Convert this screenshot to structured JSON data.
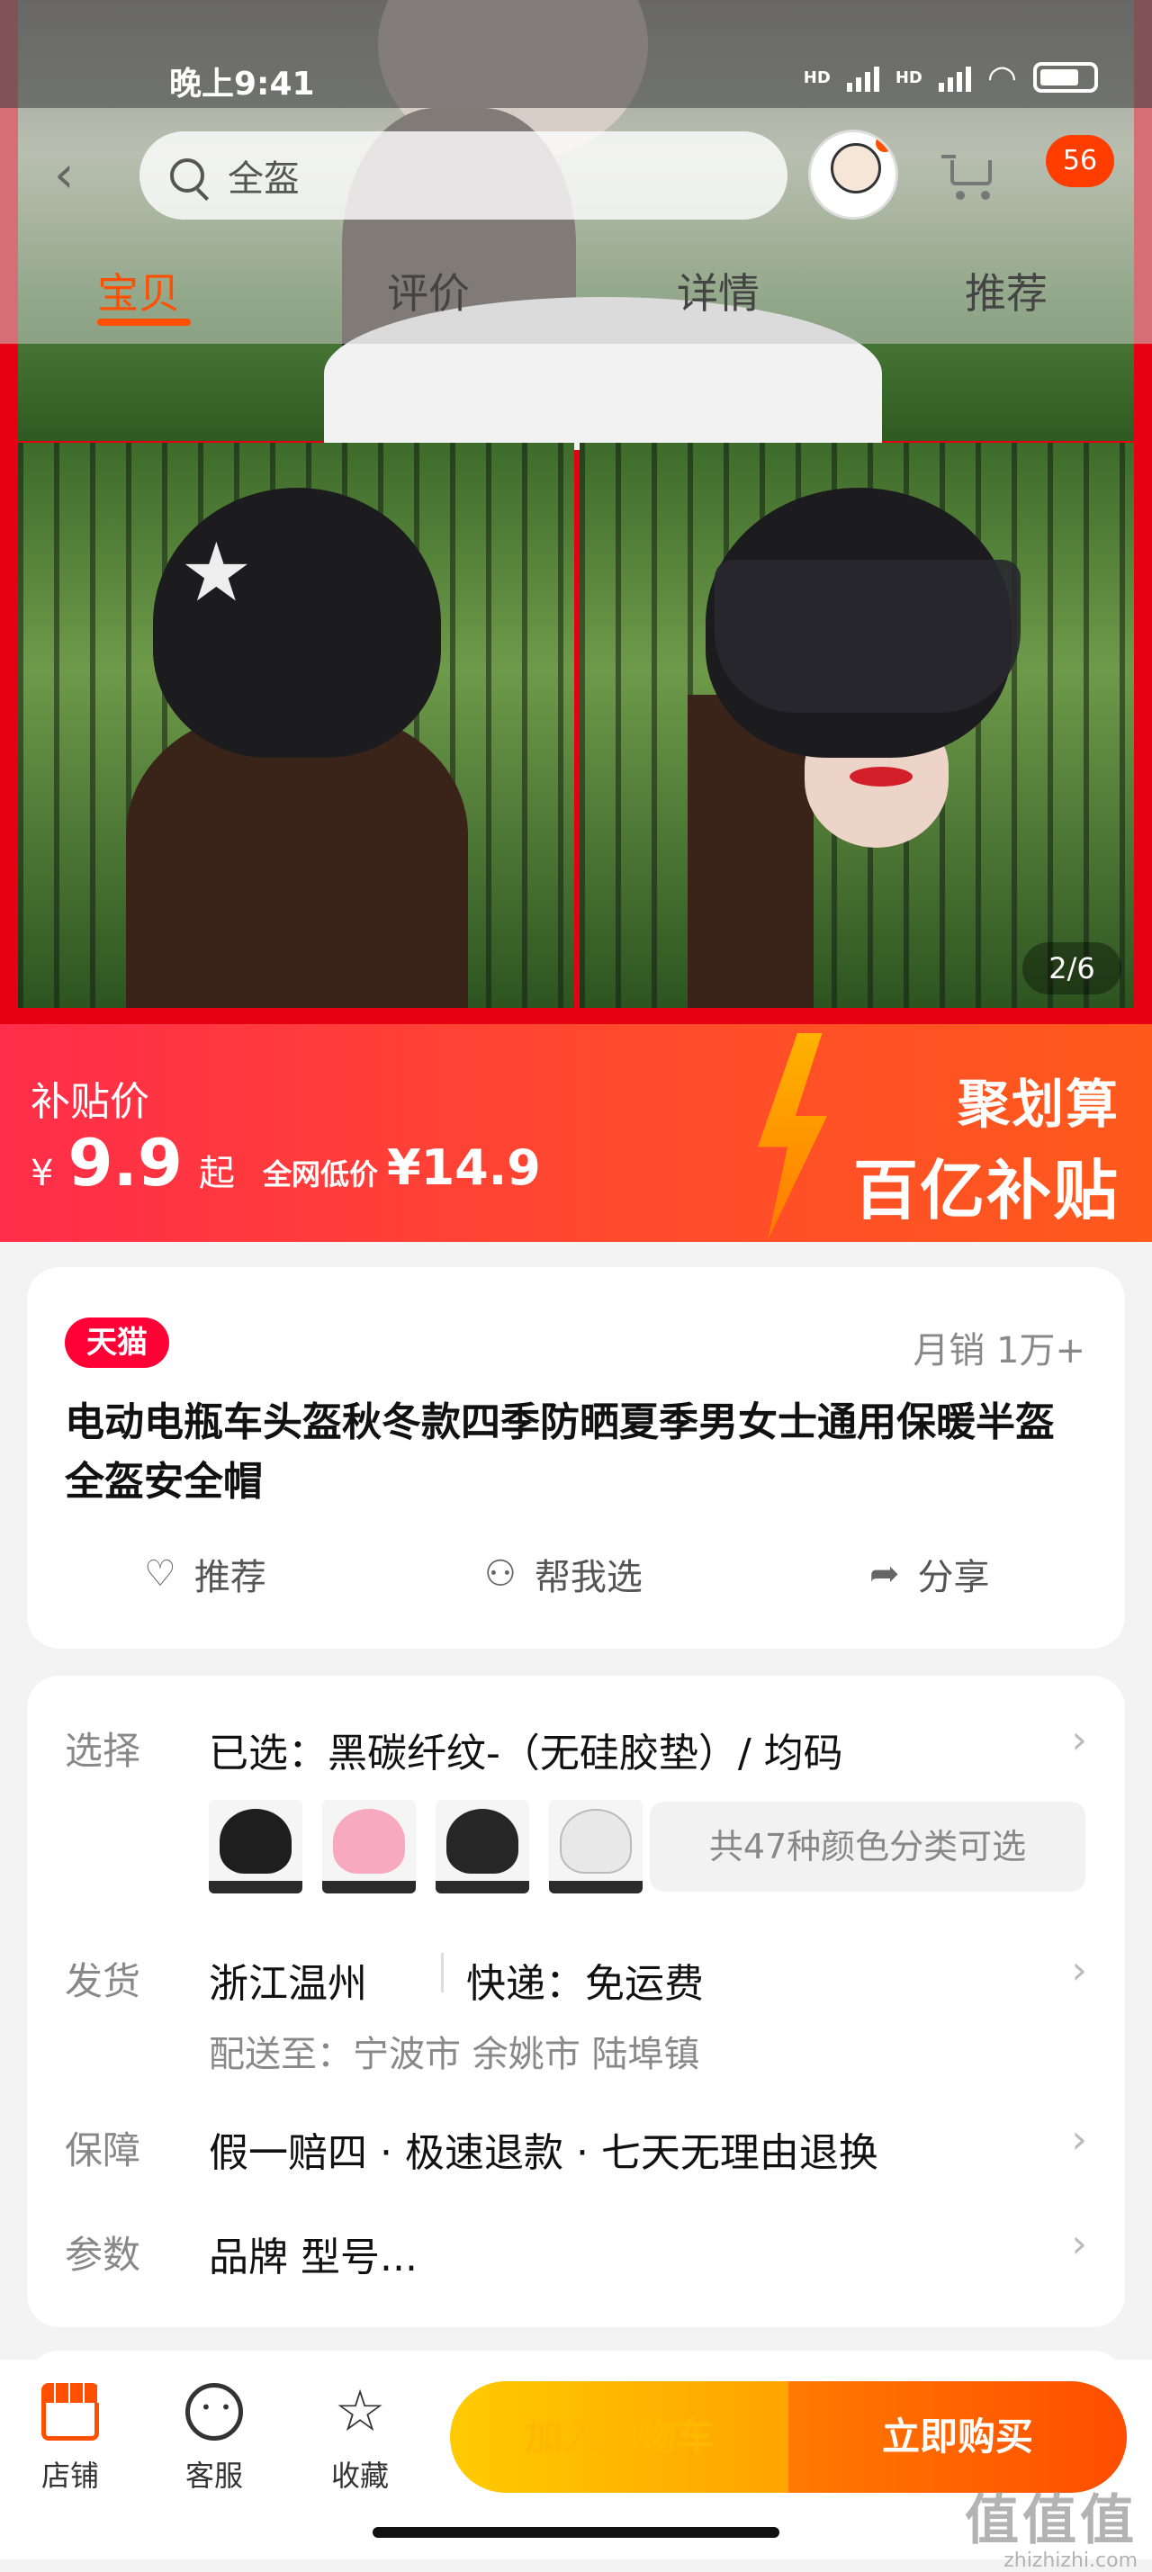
{
  "status_bar": {
    "time": "晚上9:41",
    "signal1": "HD",
    "signal2": "HD"
  },
  "header": {
    "search_placeholder": "全盔",
    "cart_badge": "56"
  },
  "tabs": [
    {
      "label": "宝贝",
      "active": true
    },
    {
      "label": "评价",
      "active": false
    },
    {
      "label": "详情",
      "active": false
    },
    {
      "label": "推荐",
      "active": false
    }
  ],
  "gallery": {
    "indicator": "2/6"
  },
  "price_banner": {
    "subsidy_label": "补贴价",
    "currency": "¥",
    "price": "9.9",
    "price_suffix": "起",
    "net_low_label": "全网低价",
    "net_low_value": "¥14.9",
    "promo_line1": "聚划算",
    "promo_line2": "百亿补贴"
  },
  "product": {
    "store_badge": "天猫",
    "monthly_sales": "月销 1万+",
    "title": "电动电瓶车头盔秋冬款四季防晒夏季男女士通用保暖半盔全盔安全帽",
    "actions": [
      {
        "icon": "heart-icon",
        "label": "推荐"
      },
      {
        "icon": "people-icon",
        "label": "帮我选"
      },
      {
        "icon": "share-icon",
        "label": "分享"
      }
    ]
  },
  "details": {
    "select_label": "选择",
    "select_value": "已选：黑碳纤纹-（无硅胶垫）/ 均码",
    "color_count": "共47种颜色分类可选",
    "ship_label": "发货",
    "ship_from": "浙江温州",
    "ship_express": "快递：免运费",
    "ship_to": "配送至：宁波市 余姚市 陆埠镇",
    "guarantee_label": "保障",
    "guarantee_value": "假一赔四 · 极速退款 · 七天无理由退换",
    "params_label": "参数",
    "params_value": "品牌 型号..."
  },
  "bottom_bar": {
    "shop": "店铺",
    "service": "客服",
    "favorite": "收藏",
    "add_to_cart": "加入购物车",
    "buy_now": "立即购买"
  },
  "watermark": {
    "brand": "值值值",
    "url": "zhizhizhi.com"
  },
  "colors": {
    "accent": "#ff5000",
    "tmall": "#ff0036",
    "banner": "#ff2d4a"
  }
}
